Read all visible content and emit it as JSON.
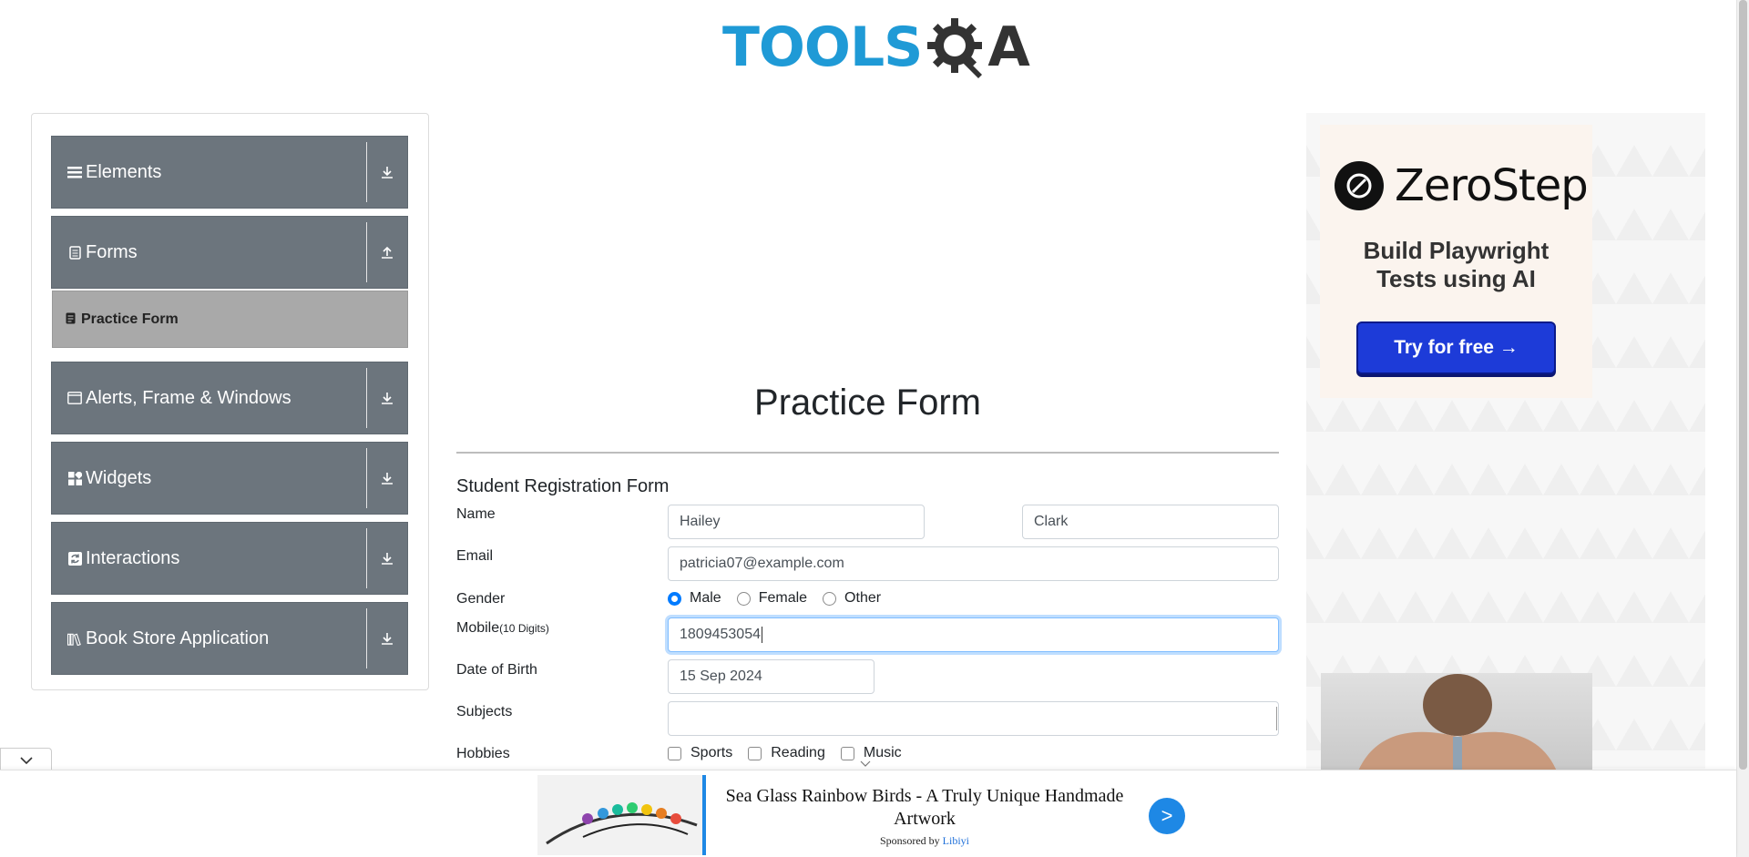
{
  "header": {
    "logo_main": "TOOLS",
    "logo_suffix": "A"
  },
  "sidebar": {
    "groups": [
      {
        "label": "Elements",
        "icon": "hamburger-icon",
        "arrow": "download-arrow-icon"
      },
      {
        "label": "Forms",
        "icon": "document-icon",
        "arrow": "upload-arrow-icon",
        "expanded": true
      },
      {
        "label": "Alerts, Frame & Windows",
        "icon": "window-icon",
        "arrow": "download-arrow-icon"
      },
      {
        "label": "Widgets",
        "icon": "widgets-icon",
        "arrow": "download-arrow-icon"
      },
      {
        "label": "Interactions",
        "icon": "refresh-icon",
        "arrow": "download-arrow-icon"
      },
      {
        "label": "Book Store Application",
        "icon": "books-icon",
        "arrow": "download-arrow-icon"
      }
    ],
    "active_item": {
      "label": "Practice Form",
      "icon": "form-icon"
    }
  },
  "main": {
    "title": "Practice Form",
    "form_heading": "Student Registration Form",
    "labels": {
      "name": "Name",
      "email": "Email",
      "gender": "Gender",
      "mobile": "Mobile",
      "mobile_hint": "(10 Digits)",
      "dob": "Date of Birth",
      "subjects": "Subjects",
      "hobbies": "Hobbies"
    },
    "fields": {
      "first_name": "Hailey",
      "last_name": "Clark",
      "email": "patricia07@example.com",
      "mobile": "1809453054",
      "dob": "15 Sep 2024",
      "subjects": ""
    },
    "gender_options": [
      "Male",
      "Female",
      "Other"
    ],
    "gender_selected": "Male",
    "hobby_options": [
      "Sports",
      "Reading",
      "Music"
    ]
  },
  "right_ad": {
    "brand": "ZeroStep",
    "tagline_line1": "Build Playwright",
    "tagline_line2": "Tests using AI",
    "cta": "Try for free →"
  },
  "bottom_ad": {
    "title": "Sea Glass Rainbow Birds - A Truly Unique Handmade Artwork",
    "sponsored_prefix": "Sponsored by",
    "sponsor": "Libiyi",
    "go": ">"
  },
  "colors": {
    "sidebar_group": "#6c757d",
    "sidebar_active": "#a9a9a9",
    "logo_blue": "#1f9ad6",
    "accent_blue": "#007bff",
    "cta_blue": "#1d3bd8"
  }
}
